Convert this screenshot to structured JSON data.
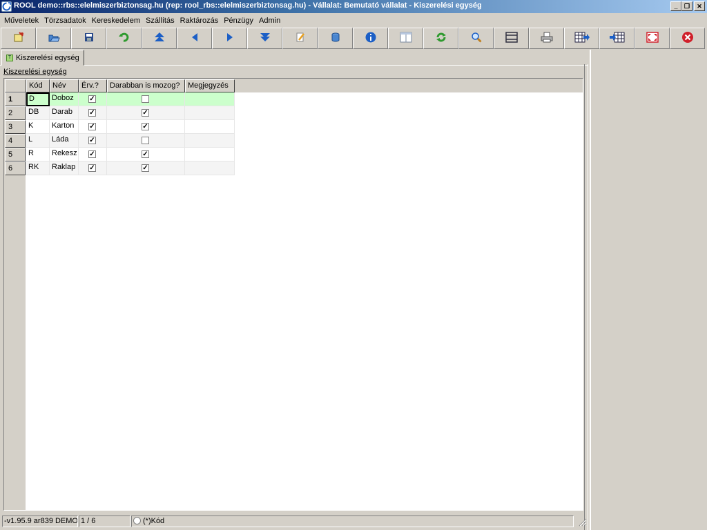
{
  "window": {
    "title": "ROOL demo::rbs::elelmiszerbiztonsag.hu (rep: rool_rbs::elelmiszerbiztonsag.hu) - Vállalat: Bemutató vállalat - Kiszerelési egység",
    "minimize_glyph": "_",
    "restore_glyph": "❐",
    "close_glyph": "✕"
  },
  "menu": [
    {
      "label": "Műveletek"
    },
    {
      "label": "Törzsadatok"
    },
    {
      "label": "Kereskedelem"
    },
    {
      "label": "Szállítás"
    },
    {
      "label": "Raktározás"
    },
    {
      "label": "Pénzügy"
    },
    {
      "label": "Admin"
    }
  ],
  "toolbar": {
    "icons": [
      "new-record-icon",
      "open-folder-icon",
      "save-icon",
      "undo-icon",
      "first-record-icon",
      "previous-record-icon",
      "next-record-icon",
      "last-record-icon",
      "edit-icon",
      "database-icon",
      "info-icon",
      "form-view-icon",
      "refresh-icon",
      "search-icon",
      "columns-icon",
      "print-icon",
      "grid-export-icon",
      "grid-import-icon",
      "fullscreen-icon",
      "close-window-icon"
    ],
    "colors": {
      "green": "#2e9a2e",
      "blue": "#1c5fc6",
      "red": "#d0202a",
      "yellow": "#e8c23a"
    }
  },
  "tab": {
    "label": "Kiszerelési egység",
    "icon_letter": "T"
  },
  "section_label": "Kiszerelési egység",
  "grid": {
    "columns": [
      "Kód",
      "Név",
      "Érv.?",
      "Darabban is mozog?",
      "Megjegyzés"
    ],
    "rows": [
      {
        "num": "1",
        "kod": "D",
        "nev": "Doboz",
        "erv": true,
        "darab": false,
        "megj": ""
      },
      {
        "num": "2",
        "kod": "DB",
        "nev": "Darab",
        "erv": true,
        "darab": true,
        "megj": ""
      },
      {
        "num": "3",
        "kod": "K",
        "nev": "Karton",
        "erv": true,
        "darab": true,
        "megj": ""
      },
      {
        "num": "4",
        "kod": "L",
        "nev": "Láda",
        "erv": true,
        "darab": false,
        "megj": ""
      },
      {
        "num": "5",
        "kod": "R",
        "nev": "Rekesz",
        "erv": true,
        "darab": true,
        "megj": ""
      },
      {
        "num": "6",
        "kod": "RK",
        "nev": "Raklap",
        "erv": true,
        "darab": true,
        "megj": ""
      }
    ],
    "selected_row_color": "#ccffcc",
    "alt_row_color": "#f4f4f4"
  },
  "status": {
    "version": "-v1.95.9 ar839 DEMO",
    "record_position": "1 / 6",
    "sort_field": "(*)Kód"
  }
}
